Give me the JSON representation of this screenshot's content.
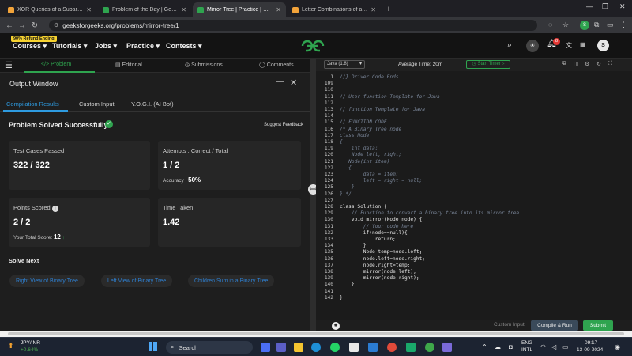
{
  "browser": {
    "tabs": [
      {
        "title": "XOR Queries of a Subarray - Le",
        "active": false,
        "favicon_color": "#f2a33a"
      },
      {
        "title": "Problem of the Day | GeeksforG",
        "active": false,
        "favicon_color": "#2fa44f"
      },
      {
        "title": "Mirror Tree | Practice | Geeksfo",
        "active": true,
        "favicon_color": "#2fa44f"
      },
      {
        "title": "Letter Combinations of a Phone",
        "active": false,
        "favicon_color": "#f2a33a"
      }
    ],
    "url": "geeksforgeeks.org/problems/mirror-tree/1",
    "profile_initial": "S"
  },
  "site": {
    "refund_badge": "90% Refund Ending",
    "nav": [
      "Courses",
      "Tutorials",
      "Jobs",
      "Practice",
      "Contests"
    ],
    "notif_count": "8",
    "profile_initial": "S"
  },
  "subtabs": [
    "Problem",
    "Editorial",
    "Submissions",
    "Comments"
  ],
  "output": {
    "title": "Output Window",
    "tabs": [
      "Compilation Results",
      "Custom Input",
      "Y.O.G.I. (AI Bot)"
    ],
    "status": "Problem Solved Successfully",
    "feedback_link": "Suggest Feedback",
    "test_cases_label": "Test Cases Passed",
    "test_cases_value": "322 / 322",
    "attempts_label": "Attempts : Correct / Total",
    "attempts_value": "1 / 2",
    "accuracy_label": "Accuracy :",
    "accuracy_value": "50%",
    "points_label": "Points Scored",
    "points_value": "2 / 2",
    "total_score_label": "Your Total Score:",
    "total_score_value": "12",
    "time_label": "Time Taken",
    "time_value": "1.42",
    "solve_next_label": "Solve Next",
    "solve_next": [
      "Right View of Binary Tree",
      "Left View of Binary Tree",
      "Children Sum in a Binary Tree"
    ]
  },
  "editor": {
    "language": "Java (1.8)",
    "avg_time": "Average Time: 20m",
    "timer_button": "Start Timer",
    "lines": [
      {
        "n": "1",
        "text": "//} Driver Code Ends",
        "cls": "cm"
      },
      {
        "n": "109",
        "text": "",
        "cls": "kw"
      },
      {
        "n": "110",
        "text": "",
        "cls": "kw"
      },
      {
        "n": "111",
        "text": "// User function Template for Java",
        "cls": "cm"
      },
      {
        "n": "112",
        "text": "",
        "cls": "kw"
      },
      {
        "n": "113",
        "text": "// function Template for Java",
        "cls": "cm"
      },
      {
        "n": "114",
        "text": "",
        "cls": "kw"
      },
      {
        "n": "115",
        "text": "// FUNCTION CODE",
        "cls": "cm"
      },
      {
        "n": "116",
        "text": "/* A Binary Tree node",
        "cls": "cm"
      },
      {
        "n": "117",
        "text": "class Node",
        "cls": "cm"
      },
      {
        "n": "118",
        "text": "{",
        "cls": "cm"
      },
      {
        "n": "119",
        "text": "    int data;",
        "cls": "cm"
      },
      {
        "n": "120",
        "text": "    Node left, right;",
        "cls": "cm"
      },
      {
        "n": "121",
        "text": "   Node(int item)",
        "cls": "cm"
      },
      {
        "n": "122",
        "text": "   {",
        "cls": "cm"
      },
      {
        "n": "123",
        "text": "        data = item;",
        "cls": "cm"
      },
      {
        "n": "124",
        "text": "        left = right = null;",
        "cls": "cm"
      },
      {
        "n": "125",
        "text": "    }",
        "cls": "cm"
      },
      {
        "n": "126",
        "text": "} */",
        "cls": "cm"
      },
      {
        "n": "127",
        "text": "",
        "cls": "kw"
      },
      {
        "n": "128",
        "text": "class Solution {",
        "cls": "kw"
      },
      {
        "n": "129",
        "text": "    // Function to convert a binary tree into its mirror tree.",
        "cls": "cm"
      },
      {
        "n": "130",
        "text": "    void mirror(Node node) {",
        "cls": "kw"
      },
      {
        "n": "131",
        "text": "        // Your code here",
        "cls": "cm"
      },
      {
        "n": "132",
        "text": "        if(node==null){",
        "cls": "kw"
      },
      {
        "n": "133",
        "text": "            return;",
        "cls": "kw"
      },
      {
        "n": "134",
        "text": "        }",
        "cls": "kw"
      },
      {
        "n": "135",
        "text": "        Node temp=node.left;",
        "cls": "kw"
      },
      {
        "n": "136",
        "text": "        node.left=node.right;",
        "cls": "kw"
      },
      {
        "n": "137",
        "text": "        node.right=temp;",
        "cls": "kw"
      },
      {
        "n": "138",
        "text": "        mirror(node.left);",
        "cls": "kw"
      },
      {
        "n": "139",
        "text": "        mirror(node.right);",
        "cls": "kw"
      },
      {
        "n": "140",
        "text": "    }",
        "cls": "kw"
      },
      {
        "n": "141",
        "text": "",
        "cls": "kw"
      },
      {
        "n": "142",
        "text": "}",
        "cls": "kw"
      }
    ],
    "custom_input": "Custom Input",
    "compile_run": "Compile & Run",
    "submit": "Submit"
  },
  "taskbar": {
    "ticker_name": "JPY/INR",
    "ticker_change": "+0.64%",
    "search_label": "Search",
    "lang": "ENG",
    "lang_sub": "INTL",
    "time": "09:17",
    "date": "13-09-2024"
  },
  "colors": {
    "accent_green": "#2fa44f",
    "link_blue": "#2e9be0"
  }
}
